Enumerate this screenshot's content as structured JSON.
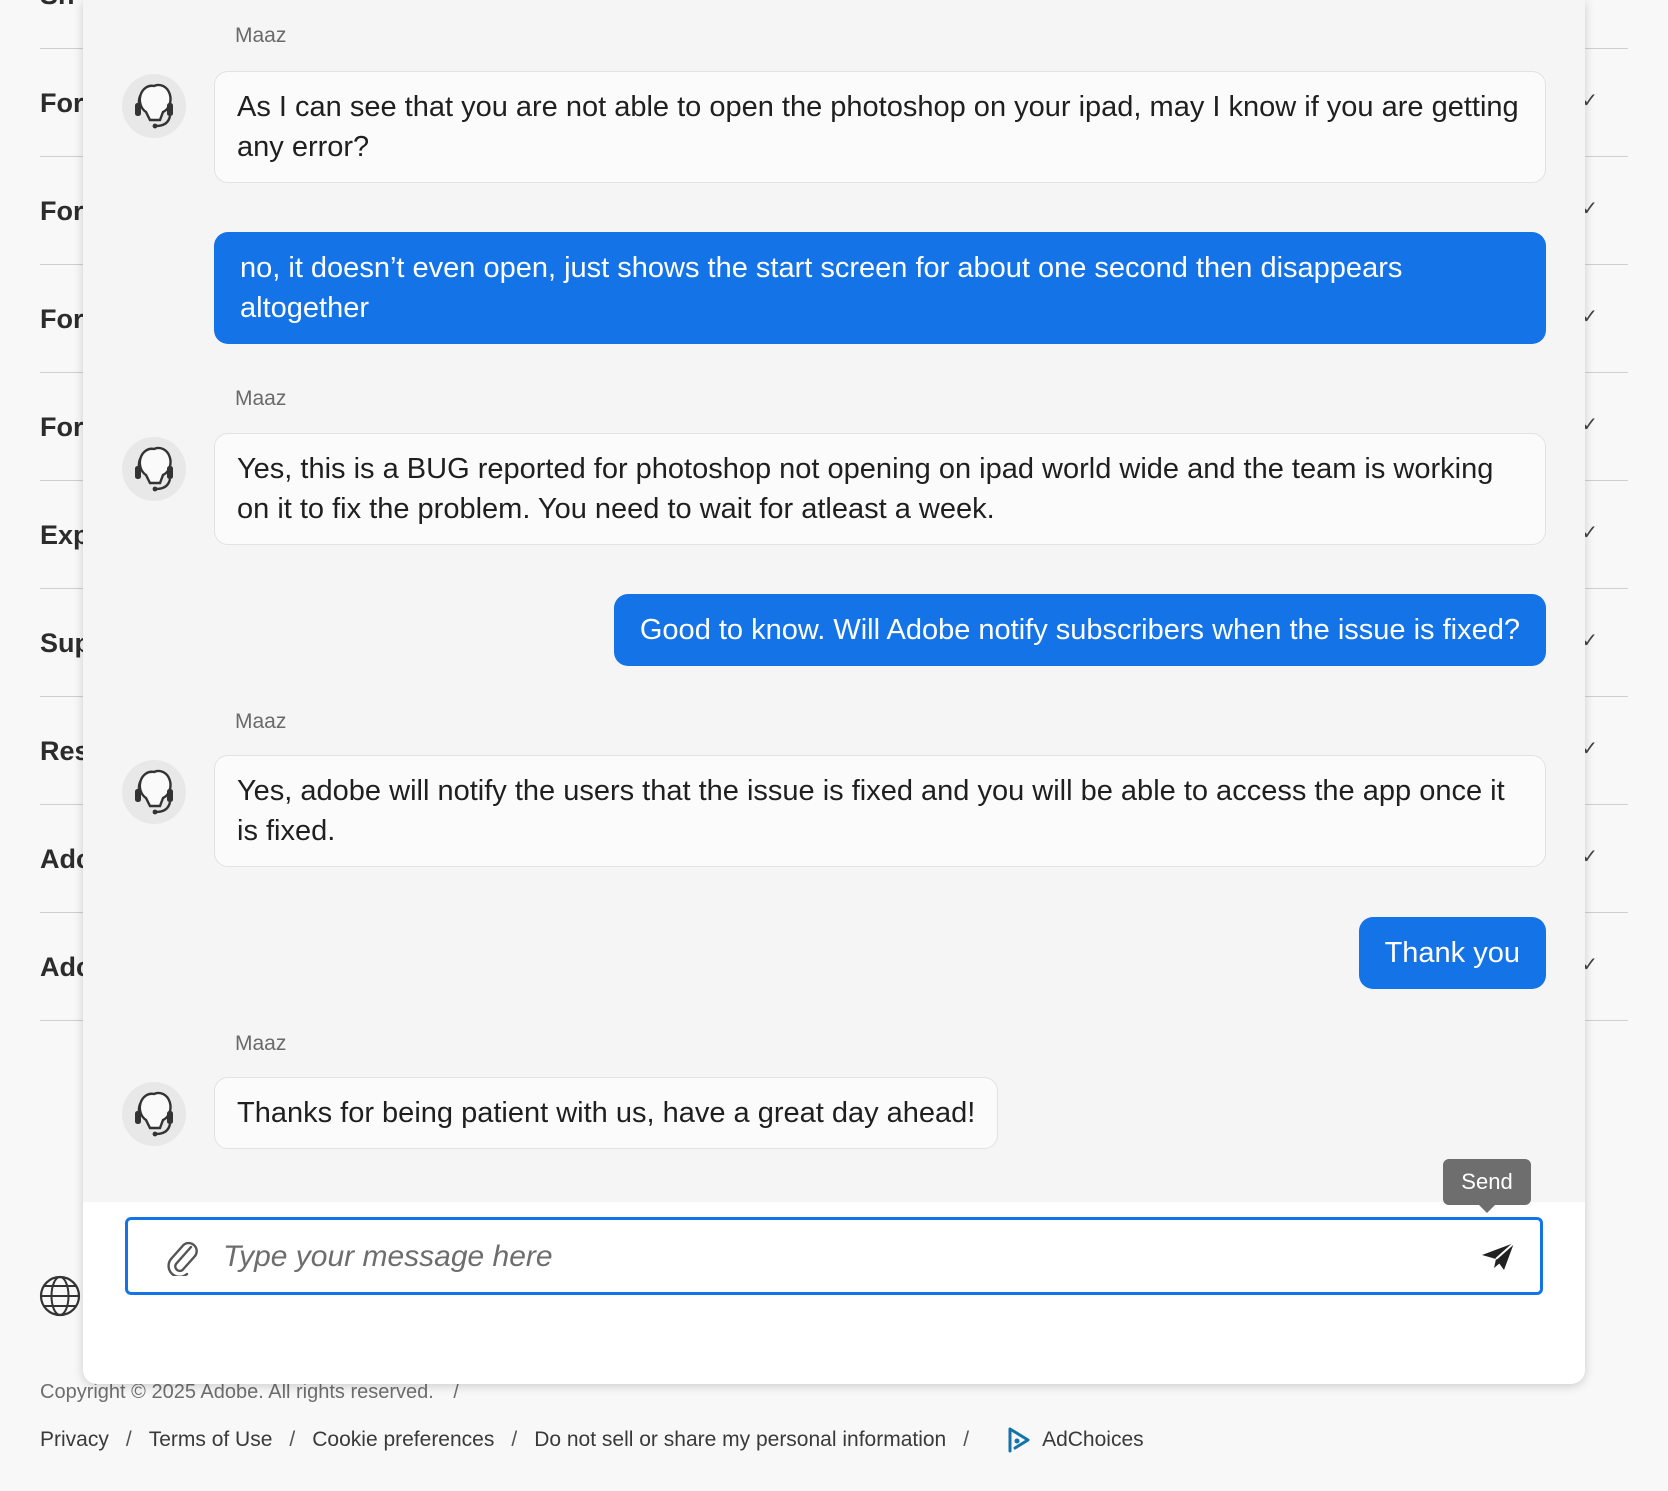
{
  "background": {
    "sections": [
      "Sh",
      "For",
      "For",
      "For",
      "For",
      "Exp",
      "Sup",
      "Res",
      "Adc",
      "Adc"
    ],
    "chevron": "✓"
  },
  "chat": {
    "messages": [
      {
        "role": "agent",
        "sender": "Maaz",
        "text": "As I can see that you are not able to open the photoshop on your ipad, may I know if you are getting any error?"
      },
      {
        "role": "user",
        "text": "no, it doesn’t even open, just shows the start screen for about one second then disappears altogether"
      },
      {
        "role": "agent",
        "sender": "Maaz",
        "text": "Yes, this is a BUG reported for photoshop not opening on ipad world wide and the team is working on it to fix the problem. You need to wait for atleast a week."
      },
      {
        "role": "user",
        "text": "Good to know. Will Adobe notify subscribers when the issue is fixed?"
      },
      {
        "role": "agent",
        "sender": "Maaz",
        "text": "Yes, adobe will notify the users that the issue is fixed and you will be able to access the app once it is fixed."
      },
      {
        "role": "user",
        "text": "Thank you"
      },
      {
        "role": "agent",
        "sender": "Maaz",
        "text": "Thanks for being patient with us, have a great day ahead!"
      }
    ],
    "input": {
      "placeholder": "Type your message here",
      "value": ""
    },
    "send_tooltip": "Send",
    "icons": {
      "attach": "paperclip-icon",
      "send": "paper-plane-icon",
      "avatar": "headset-icon"
    },
    "colors": {
      "user_bubble": "#1473e6",
      "input_border": "#1473e6"
    }
  },
  "footer": {
    "copyright": "Copyright © 2025 Adobe. All rights reserved.",
    "copyright_sep": "/",
    "links": [
      "Privacy",
      "Terms of Use",
      "Cookie preferences",
      "Do not sell or share my personal information"
    ],
    "separator": "/",
    "adchoices": "AdChoices"
  }
}
